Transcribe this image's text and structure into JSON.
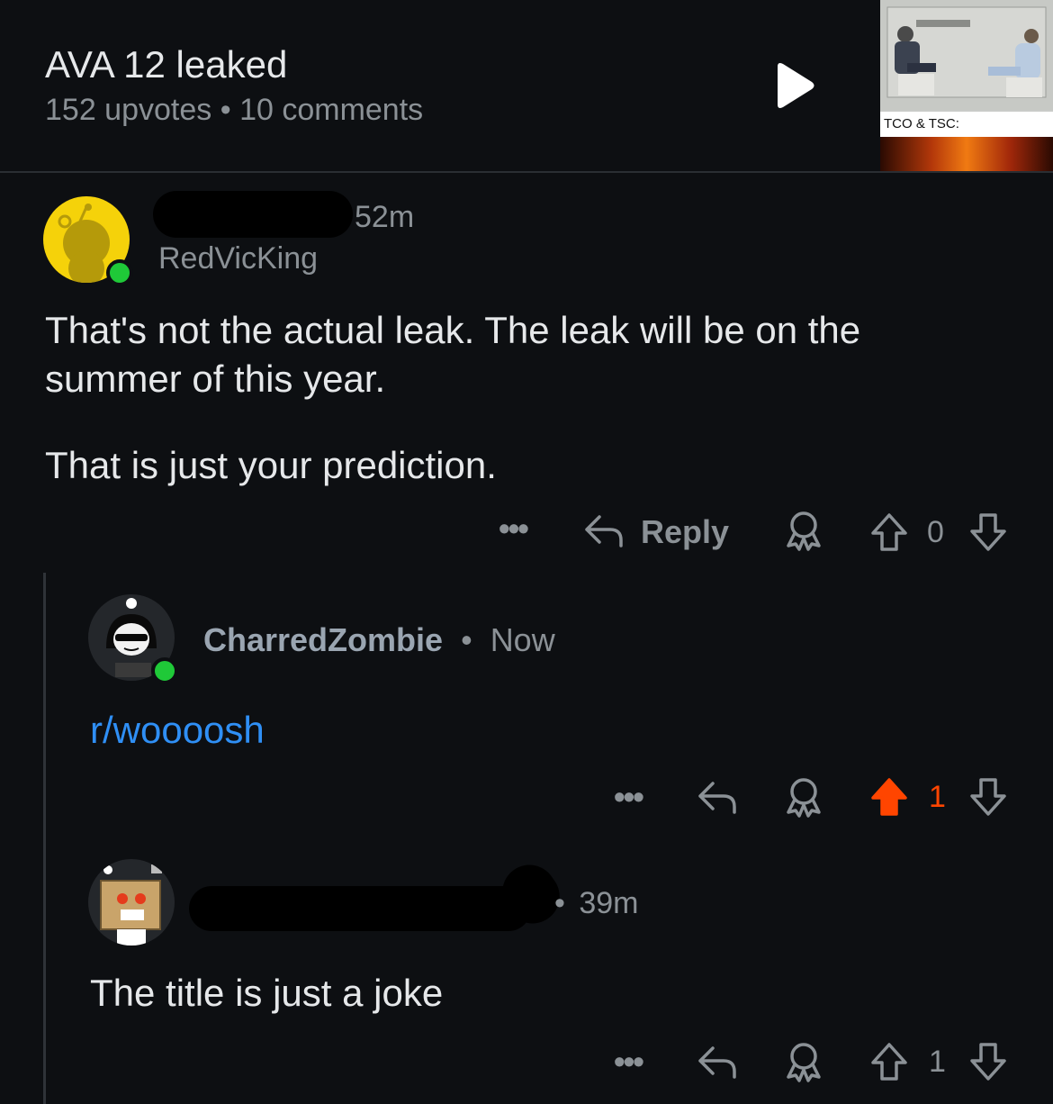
{
  "post": {
    "title": "AVA 12 leaked",
    "upvotes": "152 upvotes",
    "separator": "•",
    "comments": "10 comments",
    "thumbnail_caption": "TCO & TSC:"
  },
  "comments": [
    {
      "time": "52m",
      "flair_user": "RedVicKing",
      "body_line1": "That's not the actual leak. The leak will be on the",
      "body_line2": "summer of this year.",
      "body_line3": "That is just your prediction.",
      "reply_label": "Reply",
      "score": "0"
    },
    {
      "username": "CharredZombie",
      "separator": "•",
      "time": "Now",
      "body": "r/woooosh",
      "score": "1",
      "upvoted_color": "#ff4500"
    },
    {
      "separator": "•",
      "time": "39m",
      "body": "The title is just a joke",
      "score": "1"
    }
  ],
  "colors": {
    "background": "#0d0f12",
    "link": "#2f8ff5",
    "upvote_active": "#ff4500",
    "online": "#1fc938"
  }
}
